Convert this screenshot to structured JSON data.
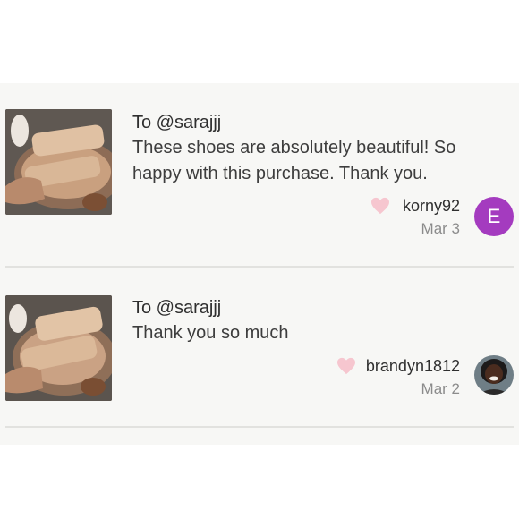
{
  "notes": [
    {
      "recipient": "To @sarajjj",
      "message": "These shoes are absolutely beautiful! So happy with this purchase. Thank you.",
      "author": "korny92",
      "date": "Mar 3",
      "avatar_letter": "E",
      "avatar_color": "#a43bbf"
    },
    {
      "recipient": "To @sarajjj",
      "message": "Thank you so much",
      "author": "brandyn1812",
      "date": "Mar 2",
      "avatar_letter": "",
      "avatar_color": ""
    }
  ],
  "icons": {
    "like": "heart-icon"
  },
  "colors": {
    "heart": "#f6c6cf",
    "panel_background": "#f7f7f5",
    "divider": "#e2e2df"
  }
}
